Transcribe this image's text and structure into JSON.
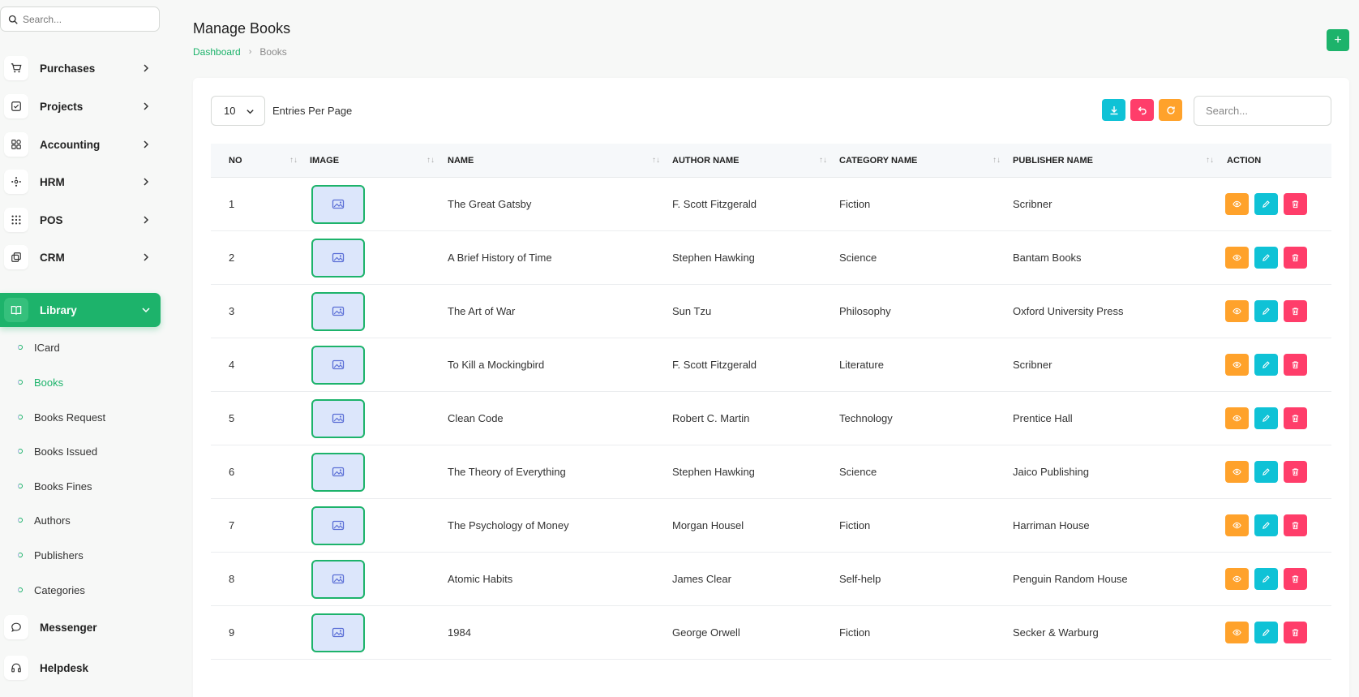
{
  "sidebar": {
    "search_placeholder": "Search...",
    "items": [
      {
        "label": "Purchases",
        "icon": "cart-icon"
      },
      {
        "label": "Projects",
        "icon": "checkbox-icon"
      },
      {
        "label": "Accounting",
        "icon": "grid-icon"
      },
      {
        "label": "HRM",
        "icon": "nodes-icon"
      },
      {
        "label": "POS",
        "icon": "dots-grid-icon"
      },
      {
        "label": "CRM",
        "icon": "layers-icon"
      },
      {
        "label": "Library",
        "icon": "book-icon",
        "active": true
      }
    ],
    "library_sub": [
      {
        "label": "ICard"
      },
      {
        "label": "Books",
        "active": true
      },
      {
        "label": "Books Request"
      },
      {
        "label": "Books Issued"
      },
      {
        "label": "Books Fines"
      },
      {
        "label": "Authors"
      },
      {
        "label": "Publishers"
      },
      {
        "label": "Categories"
      }
    ],
    "bottom_items": [
      {
        "label": "Messenger",
        "icon": "chat-icon"
      },
      {
        "label": "Helpdesk",
        "icon": "headset-icon"
      }
    ]
  },
  "header": {
    "title": "Manage Books",
    "breadcrumb": {
      "link": "Dashboard",
      "separator": "›",
      "current": "Books"
    },
    "add_label": "+"
  },
  "toolbar": {
    "entries_value": "10",
    "entries_label": "Entries Per Page",
    "search_placeholder": "Search..."
  },
  "table": {
    "columns": [
      "NO",
      "IMAGE",
      "NAME",
      "AUTHOR NAME",
      "CATEGORY NAME",
      "PUBLISHER NAME",
      "ACTION"
    ],
    "rows": [
      {
        "no": "1",
        "name": "The Great Gatsby",
        "author": "F. Scott Fitzgerald",
        "category": "Fiction",
        "publisher": "Scribner"
      },
      {
        "no": "2",
        "name": "A Brief History of Time",
        "author": "Stephen Hawking",
        "category": "Science",
        "publisher": "Bantam Books"
      },
      {
        "no": "3",
        "name": "The Art of War",
        "author": "Sun Tzu",
        "category": "Philosophy",
        "publisher": "Oxford University Press"
      },
      {
        "no": "4",
        "name": "To Kill a Mockingbird",
        "author": "F. Scott Fitzgerald",
        "category": "Literature",
        "publisher": "Scribner"
      },
      {
        "no": "5",
        "name": "Clean Code",
        "author": "Robert C. Martin",
        "category": "Technology",
        "publisher": "Prentice Hall"
      },
      {
        "no": "6",
        "name": "The Theory of Everything",
        "author": "Stephen Hawking",
        "category": "Science",
        "publisher": "Jaico Publishing"
      },
      {
        "no": "7",
        "name": "The Psychology of Money",
        "author": "Morgan Housel",
        "category": "Fiction",
        "publisher": "Harriman House"
      },
      {
        "no": "8",
        "name": "Atomic Habits",
        "author": "James Clear",
        "category": "Self-help",
        "publisher": "Penguin Random House"
      },
      {
        "no": "9",
        "name": "1984",
        "author": "George Orwell",
        "category": "Fiction",
        "publisher": "Secker & Warburg"
      }
    ]
  },
  "colors": {
    "primary": "#1db36b",
    "view": "#ffa22b",
    "edit": "#0fc2d6",
    "delete": "#ff3d6a"
  }
}
